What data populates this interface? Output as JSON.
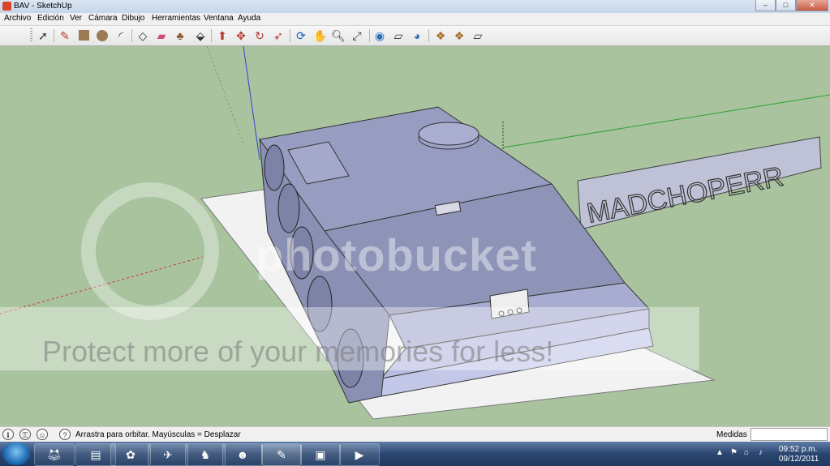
{
  "window": {
    "title": "BAV - SketchUp"
  },
  "menu": [
    "Archivo",
    "Edición",
    "Ver",
    "Cámara",
    "Dibujo",
    "Herramientas",
    "Ventana",
    "Ayuda"
  ],
  "scene": {
    "sign_text": "MADCHOPERR"
  },
  "watermark": {
    "logo_text": "photobucket",
    "protect_text": "Protect more of your memories for less!"
  },
  "status": {
    "hint": "Arrastra para orbitar.  Mayúsculas = Desplazar",
    "measurements_label": "Medidas",
    "measurements_value": ""
  },
  "taskbar": {
    "time": "09:52 p.m.",
    "date": "09/12/2011"
  },
  "colors": {
    "ground": "#a9c39f",
    "model_face": "#9aa0c4",
    "model_top": "#8f95b9",
    "paper": "#f2f2f2"
  }
}
